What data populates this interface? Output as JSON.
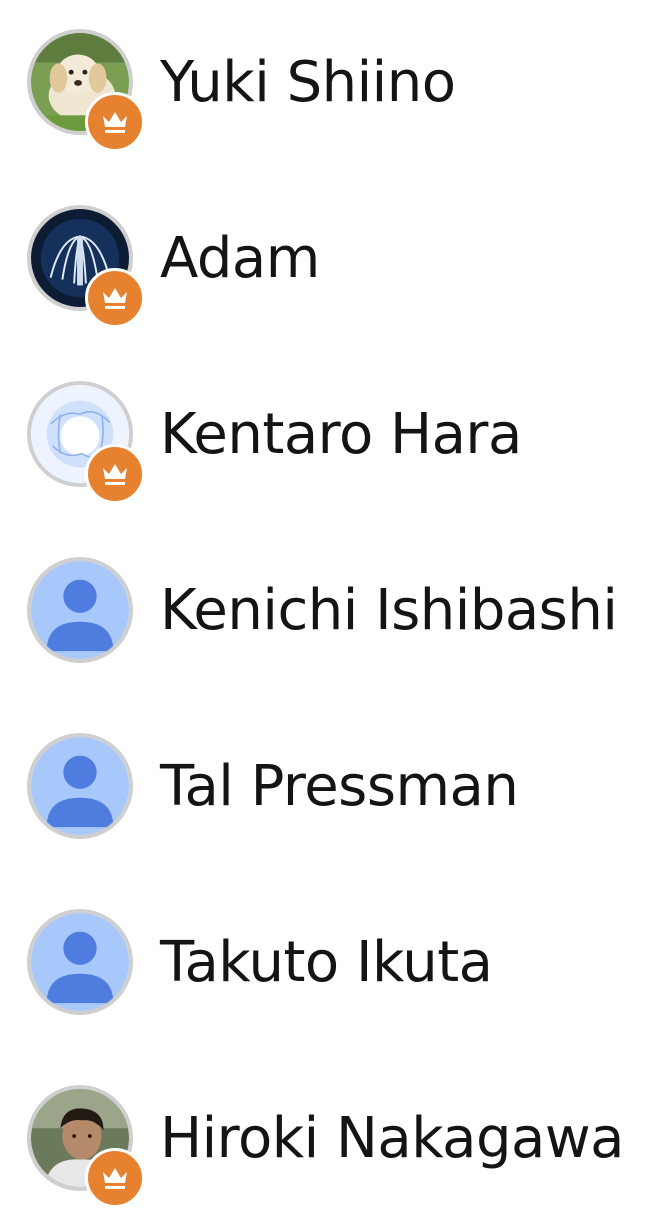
{
  "members": [
    {
      "name": "Yuki Shiino",
      "avatar": "puppy-photo",
      "owner": true
    },
    {
      "name": "Adam",
      "avatar": "fountain-photo",
      "owner": true
    },
    {
      "name": "Kentaro Hara",
      "avatar": "fractal-photo",
      "owner": true
    },
    {
      "name": "Kenichi Ishibashi",
      "avatar": "default-person",
      "owner": false
    },
    {
      "name": "Tal Pressman",
      "avatar": "default-person",
      "owner": false
    },
    {
      "name": "Takuto Ikuta",
      "avatar": "default-person",
      "owner": false
    },
    {
      "name": "Hiroki Nakagawa",
      "avatar": "person-photo",
      "owner": true
    }
  ],
  "colors": {
    "owner_badge": "#e6822f",
    "default_avatar_bg": "#a8c7fa",
    "default_avatar_fg": "#4f7ddf",
    "avatar_ring": "#cfcfcf",
    "text": "#141414"
  }
}
